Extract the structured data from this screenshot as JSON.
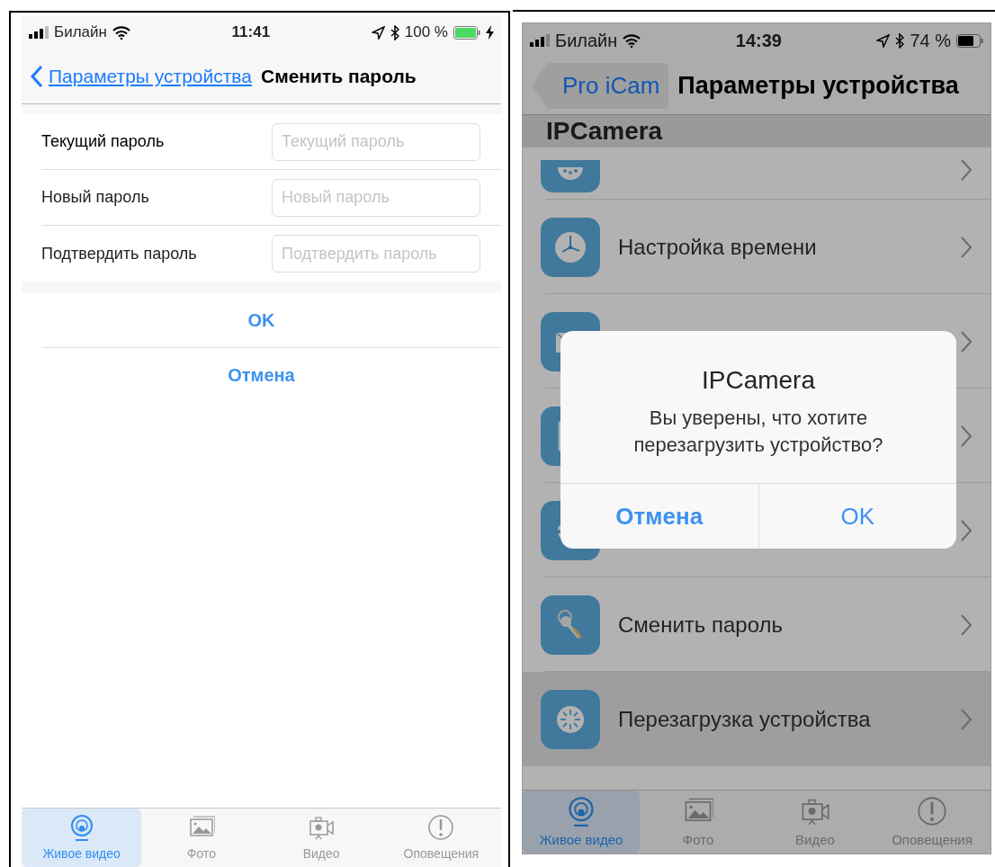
{
  "screens": [
    {
      "kind": "form",
      "dimmed": false,
      "status_bar": {
        "carrier": "Билайн",
        "time": "11:41",
        "battery": "100 %",
        "charging": true
      },
      "nav": {
        "back": "Параметры устройства",
        "title": "Сменить пароль"
      },
      "fields": [
        {
          "label": "Текущий пароль",
          "placeholder": "Текущий пароль"
        },
        {
          "label": "Новый пароль",
          "placeholder": "Новый пароль"
        },
        {
          "label": "Подтвердить пароль",
          "placeholder": "Подтвердить пароль"
        }
      ],
      "actions": [
        "OK",
        "Отмена"
      ],
      "tabs": [
        {
          "kind": "live",
          "label": "Живое видео",
          "selected": true
        },
        {
          "kind": "photo",
          "label": "Фото",
          "selected": false
        },
        {
          "kind": "video",
          "label": "Видео",
          "selected": false
        },
        {
          "kind": "alert",
          "label": "Оповещения",
          "selected": false
        }
      ]
    },
    {
      "kind": "list",
      "dimmed": true,
      "status_bar": {
        "carrier": "Билайн",
        "time": "14:39",
        "battery": "74 %",
        "charging": false
      },
      "nav": {
        "back": "Pro iCam",
        "title": "Параметры устройства"
      },
      "section": "IPCamera",
      "items": [
        {
          "kind": "dots",
          "cut": true,
          "selected": false
        },
        {
          "kind": "clock",
          "label": "Настройка времени",
          "selected": false
        },
        {
          "kind": "mail",
          "selected": false
        },
        {
          "kind": "film",
          "selected": false
        },
        {
          "kind": "gear",
          "selected": false
        },
        {
          "kind": "key",
          "label": "Сменить пароль",
          "selected": false
        },
        {
          "kind": "restart",
          "label": "Перезагрузка устройства",
          "selected": true
        }
      ],
      "alert": {
        "title": "IPCamera",
        "message": "Вы уверены, что хотите перезагрузить устройство?",
        "buttons": [
          "Отмена",
          "OK"
        ]
      },
      "tabs": [
        {
          "kind": "live",
          "label": "Живое видео",
          "selected": true
        },
        {
          "kind": "photo",
          "label": "Фото",
          "selected": false
        },
        {
          "kind": "video",
          "label": "Видео",
          "selected": false
        },
        {
          "kind": "alert",
          "label": "Оповещения",
          "selected": false
        }
      ]
    }
  ]
}
